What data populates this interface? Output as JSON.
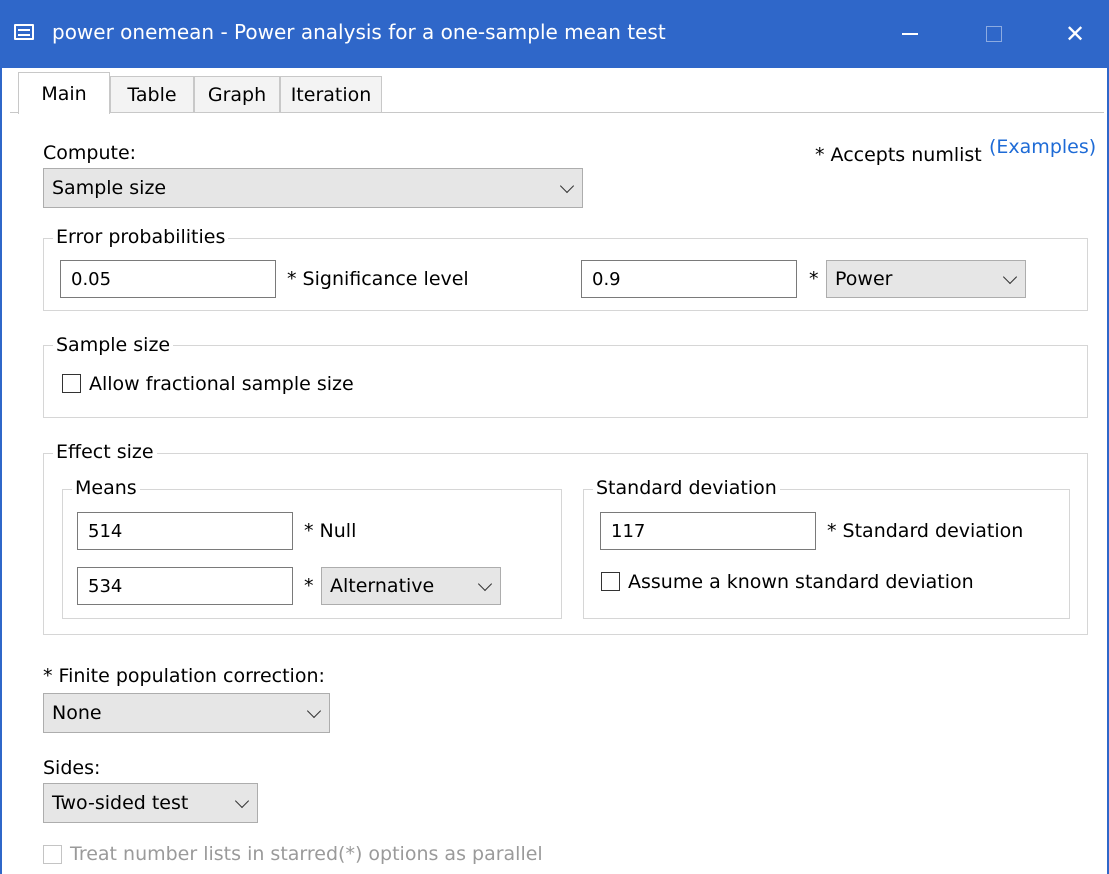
{
  "window": {
    "title": "power onemean - Power analysis for a one-sample mean test",
    "title_bar_color": "#2f67c9",
    "close_glyph": "✕"
  },
  "tabs": [
    {
      "label": "Main",
      "active": true
    },
    {
      "label": "Table",
      "active": false
    },
    {
      "label": "Graph",
      "active": false
    },
    {
      "label": "Iteration",
      "active": false
    }
  ],
  "main": {
    "compute_label": "Compute:",
    "compute_value": "Sample size",
    "accepts_numlist": "* Accepts numlist",
    "examples_link": "(Examples)",
    "error_probabilities": {
      "title": "Error probabilities",
      "significance_value": "0.05",
      "significance_label": "* Significance level",
      "power_value": "0.9",
      "power_star": "*",
      "power_select": "Power"
    },
    "sample_size": {
      "title": "Sample size",
      "fractional_label": "Allow fractional sample size",
      "fractional_checked": false
    },
    "effect_size": {
      "title": "Effect size",
      "means": {
        "title": "Means",
        "null_value": "514",
        "null_label": "* Null",
        "alt_value": "534",
        "alt_star": "*",
        "alt_select": "Alternative"
      },
      "standard_deviation": {
        "title": "Standard deviation",
        "value": "117",
        "label": "* Standard deviation",
        "known_label": "Assume a known standard deviation",
        "known_checked": false
      }
    },
    "finite_population": {
      "label": "* Finite population correction:",
      "value": "None"
    },
    "sides": {
      "label": "Sides:",
      "value": "Two-sided test"
    },
    "parallel": {
      "label": "Treat number lists in starred(*) options as parallel",
      "checked": false,
      "disabled": true
    }
  },
  "colors": {
    "accent": "#2f67c9",
    "link": "#1e6bd6",
    "combo_bg": "#e6e6e6",
    "disabled_text": "#9a9a9a"
  }
}
